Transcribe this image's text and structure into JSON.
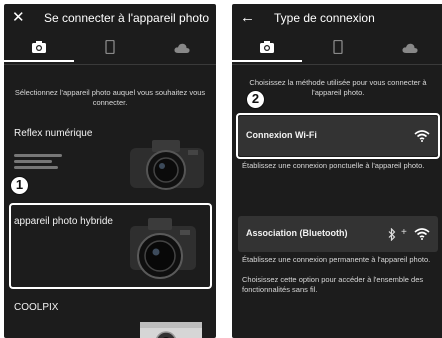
{
  "left_screen": {
    "title": "Se connecter à l'appareil photo",
    "close_icon": "close-icon",
    "tabs": [
      {
        "name": "camera-tab",
        "icon": "camera-icon",
        "active": true
      },
      {
        "name": "smartphone-tab",
        "icon": "smartphone-icon",
        "active": false
      },
      {
        "name": "cloud-tab",
        "icon": "cloud-icon",
        "active": false
      }
    ],
    "instruction": "Sélectionnez l'appareil photo auquel vous souhaitez vous connecter.",
    "camera_types": [
      {
        "label": "Reflex numérique"
      },
      {
        "label": "appareil photo hybride"
      },
      {
        "label": "COOLPIX"
      }
    ],
    "callout_1": "1"
  },
  "right_screen": {
    "title": "Type de connexion",
    "back_icon": "arrow-left-icon",
    "instruction": "Choisissez la méthode utilisée pour vous connecter à l'appareil photo.",
    "wifi": {
      "label": "Connexion Wi-Fi",
      "description": "Établissez une connexion ponctuelle à l'appareil photo."
    },
    "bluetooth": {
      "label": "Association (Bluetooth)",
      "plus": "+",
      "description_1": "Établissez une connexion permanente à l'appareil photo.",
      "description_2": "Choisissez cette option pour accéder à l'ensemble des fonctionnalités sans fil."
    },
    "callout_2": "2"
  },
  "colors": {
    "screen_bg": "#1c1c1c",
    "row_bg": "#333333",
    "text": "#f2f2f2",
    "highlight": "#ffffff"
  }
}
